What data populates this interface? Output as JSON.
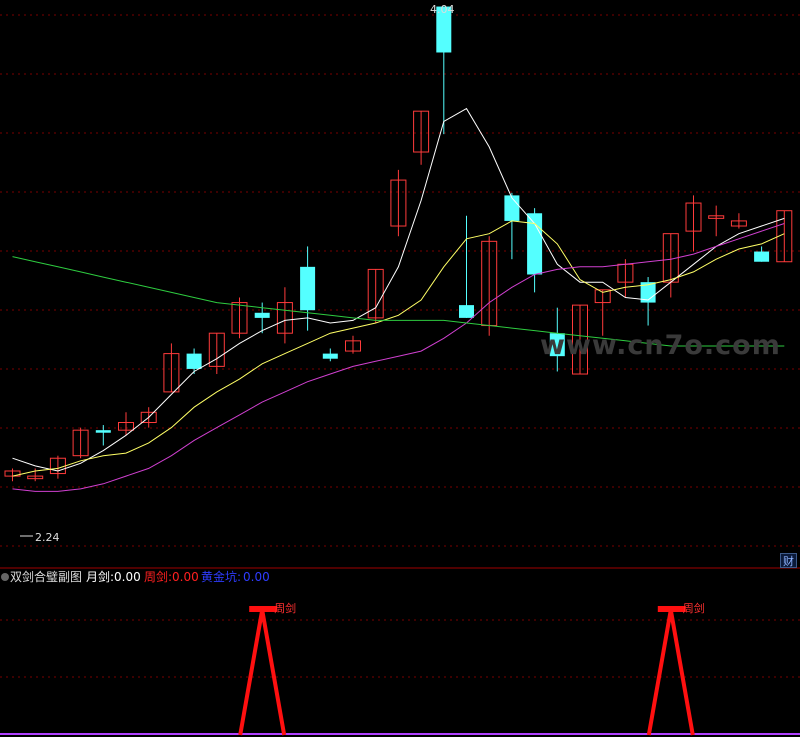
{
  "chart_data": {
    "main": {
      "type": "candlestick",
      "price_range": [
        1.99,
        4.11
      ],
      "candles": [
        {
          "o": 2.26,
          "h": 2.29,
          "l": 2.24,
          "c": 2.28
        },
        {
          "o": 2.25,
          "h": 2.29,
          "l": 2.24,
          "c": 2.26
        },
        {
          "o": 2.27,
          "h": 2.34,
          "l": 2.25,
          "c": 2.33
        },
        {
          "o": 2.34,
          "h": 2.45,
          "l": 2.33,
          "c": 2.44
        },
        {
          "o": 2.44,
          "h": 2.46,
          "l": 2.38,
          "c": 2.43
        },
        {
          "o": 2.44,
          "h": 2.51,
          "l": 2.42,
          "c": 2.47
        },
        {
          "o": 2.47,
          "h": 2.53,
          "l": 2.45,
          "c": 2.51
        },
        {
          "o": 2.59,
          "h": 2.78,
          "l": 2.59,
          "c": 2.74
        },
        {
          "o": 2.74,
          "h": 2.76,
          "l": 2.66,
          "c": 2.68
        },
        {
          "o": 2.69,
          "h": 2.81,
          "l": 2.66,
          "c": 2.82
        },
        {
          "o": 2.82,
          "h": 2.96,
          "l": 2.8,
          "c": 2.94
        },
        {
          "o": 2.9,
          "h": 2.94,
          "l": 2.82,
          "c": 2.88
        },
        {
          "o": 2.82,
          "h": 3.0,
          "l": 2.78,
          "c": 2.94
        },
        {
          "o": 3.08,
          "h": 3.16,
          "l": 2.83,
          "c": 2.91
        },
        {
          "o": 2.74,
          "h": 2.76,
          "l": 2.71,
          "c": 2.72
        },
        {
          "o": 2.75,
          "h": 2.81,
          "l": 2.74,
          "c": 2.79
        },
        {
          "o": 2.88,
          "h": 3.07,
          "l": 2.86,
          "c": 3.07
        },
        {
          "o": 3.24,
          "h": 3.46,
          "l": 3.2,
          "c": 3.42
        },
        {
          "o": 3.53,
          "h": 3.68,
          "l": 3.48,
          "c": 3.69
        },
        {
          "o": 4.1,
          "h": 4.04,
          "l": 3.6,
          "c": 3.92
        },
        {
          "o": 2.93,
          "h": 3.28,
          "l": 2.91,
          "c": 2.88
        },
        {
          "o": 2.85,
          "h": 3.2,
          "l": 2.81,
          "c": 3.18
        },
        {
          "o": 3.36,
          "h": 3.37,
          "l": 3.11,
          "c": 3.26
        },
        {
          "o": 3.29,
          "h": 3.31,
          "l": 2.98,
          "c": 3.05
        },
        {
          "o": 2.82,
          "h": 2.92,
          "l": 2.67,
          "c": 2.73
        },
        {
          "o": 2.66,
          "h": 2.93,
          "l": 2.66,
          "c": 2.93
        },
        {
          "o": 2.94,
          "h": 2.98,
          "l": 2.81,
          "c": 2.99
        },
        {
          "o": 3.02,
          "h": 3.11,
          "l": 2.96,
          "c": 3.09
        },
        {
          "o": 3.02,
          "h": 3.04,
          "l": 2.85,
          "c": 2.94
        },
        {
          "o": 3.02,
          "h": 3.18,
          "l": 2.96,
          "c": 3.21
        },
        {
          "o": 3.22,
          "h": 3.36,
          "l": 3.14,
          "c": 3.33
        },
        {
          "o": 3.27,
          "h": 3.32,
          "l": 3.2,
          "c": 3.28
        },
        {
          "o": 3.24,
          "h": 3.29,
          "l": 3.23,
          "c": 3.26
        },
        {
          "o": 3.14,
          "h": 3.16,
          "l": 3.12,
          "c": 3.1
        },
        {
          "o": 3.1,
          "h": 3.3,
          "l": 3.1,
          "c": 3.3
        }
      ],
      "ma_lines": [
        {
          "color": "#ffffff",
          "points": [
            2.33,
            2.3,
            2.28,
            2.31,
            2.36,
            2.42,
            2.49,
            2.58,
            2.67,
            2.72,
            2.78,
            2.83,
            2.87,
            2.88,
            2.86,
            2.87,
            2.92,
            3.08,
            3.34,
            3.65,
            3.7,
            3.55,
            3.35,
            3.25,
            3.09,
            3.02,
            3.02,
            2.96,
            2.95,
            3.02,
            3.09,
            3.16,
            3.21,
            3.24,
            3.27
          ]
        },
        {
          "color": "#ffff66",
          "points": [
            2.26,
            2.28,
            2.29,
            2.32,
            2.34,
            2.35,
            2.39,
            2.45,
            2.53,
            2.59,
            2.64,
            2.7,
            2.74,
            2.78,
            2.82,
            2.84,
            2.86,
            2.89,
            2.95,
            3.08,
            3.19,
            3.21,
            3.26,
            3.25,
            3.17,
            3.03,
            2.98,
            3.0,
            3.01,
            3.03,
            3.06,
            3.11,
            3.15,
            3.17,
            3.21
          ]
        },
        {
          "color": "#d040d0",
          "points": [
            2.21,
            2.2,
            2.2,
            2.21,
            2.23,
            2.26,
            2.29,
            2.34,
            2.4,
            2.45,
            2.5,
            2.55,
            2.59,
            2.63,
            2.66,
            2.69,
            2.71,
            2.73,
            2.75,
            2.8,
            2.86,
            2.94,
            3.0,
            3.05,
            3.07,
            3.08,
            3.08,
            3.09,
            3.1,
            3.11,
            3.13,
            3.16,
            3.19,
            3.22,
            3.25
          ]
        },
        {
          "color": "#2ecc40",
          "points": [
            3.12,
            3.1,
            3.08,
            3.06,
            3.04,
            3.02,
            3.0,
            2.98,
            2.96,
            2.94,
            2.93,
            2.92,
            2.91,
            2.9,
            2.89,
            2.88,
            2.87,
            2.87,
            2.87,
            2.87,
            2.86,
            2.85,
            2.84,
            2.83,
            2.82,
            2.81,
            2.8,
            2.79,
            2.78,
            2.77,
            2.77,
            2.77,
            2.77,
            2.77,
            2.77
          ]
        }
      ],
      "annotations": {
        "high": "4.04",
        "low": "2.24"
      },
      "grid": true
    },
    "sub": {
      "type": "line",
      "title": "双剑合璧副图",
      "indicators": [
        {
          "name": "月剑:",
          "value": "0.00",
          "color": "#ffffff"
        },
        {
          "name": "周剑:",
          "value": "0.00",
          "color": "#ff2020"
        },
        {
          "name": "黄金坑:",
          "value": "0.00",
          "color": "#2020ff"
        }
      ],
      "peaks": [
        {
          "index": 11,
          "label": "周剑",
          "value": 1
        },
        {
          "index": 29,
          "label": "周剑",
          "value": 1
        }
      ],
      "ylim": [
        0,
        1
      ]
    }
  },
  "badge": "财",
  "watermark": "www.cn7o.com"
}
